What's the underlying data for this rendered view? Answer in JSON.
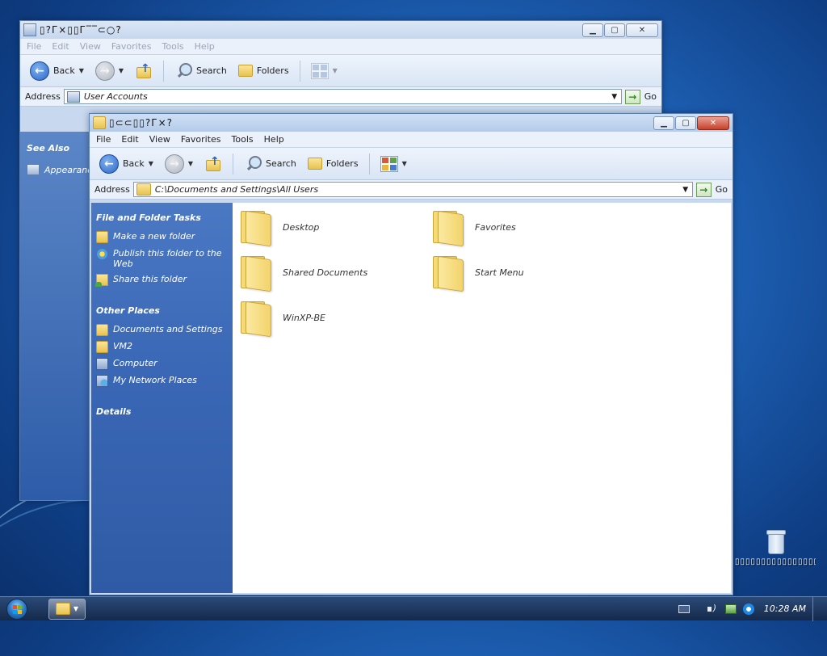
{
  "back_window": {
    "title": "▯?Г×▯▯Г‾‾⊂○?",
    "menu": [
      "File",
      "Edit",
      "View",
      "Favorites",
      "Tools",
      "Help"
    ],
    "toolbar": {
      "back": "Back",
      "search": "Search",
      "folders": "Folders"
    },
    "address": {
      "label": "Address",
      "value": "User Accounts",
      "go": "Go"
    },
    "see_also": {
      "heading": "See Also",
      "item": "Appearance"
    }
  },
  "front_window": {
    "title": "▯⊂⊂▯▯?Г×?",
    "menu": [
      "File",
      "Edit",
      "View",
      "Favorites",
      "Tools",
      "Help"
    ],
    "toolbar": {
      "back": "Back",
      "search": "Search",
      "folders": "Folders"
    },
    "address": {
      "label": "Address",
      "value": "C:\\Documents and Settings\\All Users",
      "go": "Go"
    },
    "tasks": {
      "heading": "File and Folder Tasks",
      "items": [
        "Make a new folder",
        "Publish this folder to the Web",
        "Share this folder"
      ]
    },
    "other_places": {
      "heading": "Other Places",
      "items": [
        "Documents and Settings",
        "VM2",
        "Computer",
        "My Network Places"
      ]
    },
    "details": {
      "heading": "Details"
    },
    "files": [
      "Desktop",
      "Favorites",
      "Shared Documents",
      "Start Menu",
      "WinXP-BE"
    ]
  },
  "desktop": {
    "recycle_bin_label": "▯▯▯▯▯▯▯▯▯▯▯▯▯▯▯▯"
  },
  "taskbar": {
    "clock": "10:28 AM"
  }
}
